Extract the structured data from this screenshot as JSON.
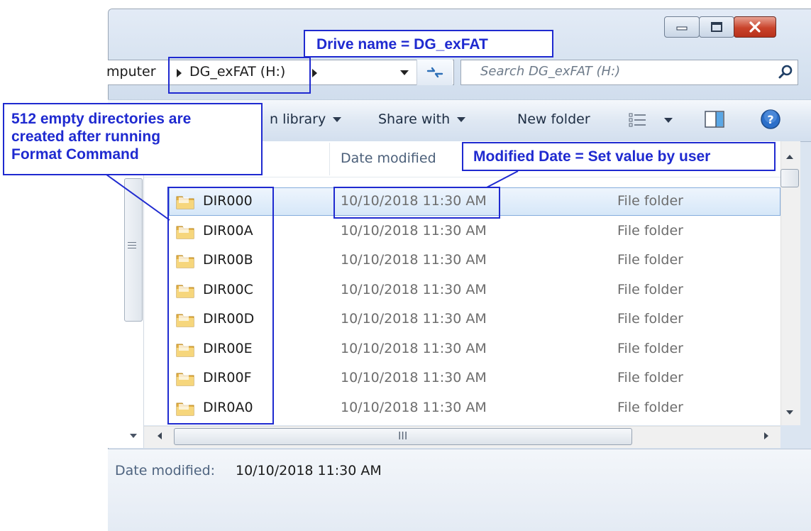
{
  "address_bar": {
    "partial_crumb": "mputer",
    "current_folder": "DG_exFAT (H:)"
  },
  "search": {
    "placeholder": "Search DG_exFAT (H:)"
  },
  "toolbar": {
    "include_in_library": "n library",
    "share_with": "Share with",
    "new_folder": "New folder"
  },
  "columns": {
    "date_modified": "Date modified"
  },
  "files": [
    {
      "name": "DIR000",
      "date": "10/10/2018 11:30 AM",
      "type": "File folder"
    },
    {
      "name": "DIR00A",
      "date": "10/10/2018 11:30 AM",
      "type": "File folder"
    },
    {
      "name": "DIR00B",
      "date": "10/10/2018 11:30 AM",
      "type": "File folder"
    },
    {
      "name": "DIR00C",
      "date": "10/10/2018 11:30 AM",
      "type": "File folder"
    },
    {
      "name": "DIR00D",
      "date": "10/10/2018 11:30 AM",
      "type": "File folder"
    },
    {
      "name": "DIR00E",
      "date": "10/10/2018 11:30 AM",
      "type": "File folder"
    },
    {
      "name": "DIR00F",
      "date": "10/10/2018 11:30 AM",
      "type": "File folder"
    },
    {
      "name": "DIR0A0",
      "date": "10/10/2018 11:30 AM",
      "type": "File folder"
    }
  ],
  "details_pane": {
    "label": "Date modified:",
    "value": "10/10/2018 11:30 AM"
  },
  "annotations": {
    "drive_name": "Drive name = DG_exFAT",
    "directories_line1": "512 empty directories are",
    "directories_line2": "created after running",
    "directories_line3": "Format Command",
    "modified_date": "Modified Date = Set value by user"
  },
  "colors": {
    "annotation": "#1f2ad0",
    "selection": "#d6e7f8",
    "close_button": "#c9432b"
  }
}
